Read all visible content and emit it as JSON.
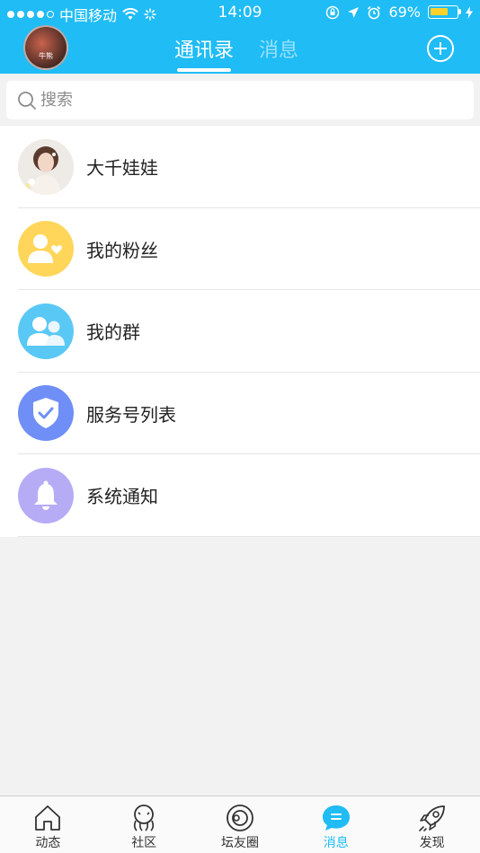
{
  "status_bar": {
    "carrier": "中国移动",
    "time": "14:09",
    "battery_percent": "69%",
    "battery_level": 0.69
  },
  "header": {
    "avatar_label": "牛熊",
    "tabs": [
      {
        "label": "通讯录",
        "active": true
      },
      {
        "label": "消息",
        "active": false
      }
    ],
    "add_icon": "plus-circle-icon"
  },
  "search": {
    "placeholder": "搜索"
  },
  "contacts": [
    {
      "label": "大千娃娃",
      "icon": "user-photo-avatar",
      "color": "#e8e4df"
    },
    {
      "label": "我的粉丝",
      "icon": "fans-icon",
      "color": "#ffd65a"
    },
    {
      "label": "我的群",
      "icon": "group-icon",
      "color": "#5ac8f5"
    },
    {
      "label": "服务号列表",
      "icon": "shield-check-icon",
      "color": "#6f8ff7"
    },
    {
      "label": "系统通知",
      "icon": "bell-icon",
      "color": "#b6acf5"
    }
  ],
  "bottom_nav": [
    {
      "label": "动态",
      "icon": "home-icon",
      "active": false
    },
    {
      "label": "社区",
      "icon": "community-icon",
      "active": false
    },
    {
      "label": "坛友圈",
      "icon": "circle-icon",
      "active": false
    },
    {
      "label": "消息",
      "icon": "message-icon",
      "active": true
    },
    {
      "label": "发现",
      "icon": "rocket-icon",
      "active": false
    }
  ],
  "colors": {
    "accent": "#1fbcf5",
    "background": "#f2f2f2"
  }
}
